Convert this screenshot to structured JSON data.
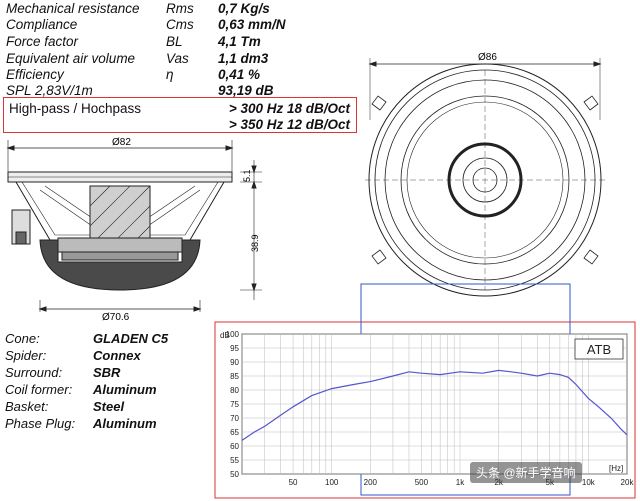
{
  "specs": [
    {
      "label": "Mechanical resistance",
      "symbol": "Rms",
      "value": "0,7 Kg/s"
    },
    {
      "label": "Compliance",
      "symbol": "Cms",
      "value": "0,63 mm/N"
    },
    {
      "label": "Force factor",
      "symbol": "BL",
      "value": "4,1 Tm"
    },
    {
      "label": "Equivalent air volume",
      "symbol": "Vas",
      "value": "1,1 dm3"
    },
    {
      "label": "Efficiency",
      "symbol": "η",
      "value": "0,41 %"
    },
    {
      "label": "SPL 2,83V/1m",
      "symbol": "",
      "value": "93,19 dB"
    }
  ],
  "highpass": {
    "label": "High-pass / Hochpass",
    "values": [
      "> 300 Hz 18 dB/Oct",
      "> 350 Hz 12 dB/Oct"
    ]
  },
  "materials": [
    {
      "label": "Cone:",
      "value": "GLADEN C5"
    },
    {
      "label": "Spider:",
      "value": "Connex"
    },
    {
      "label": "Surround:",
      "value": "SBR"
    },
    {
      "label": "Coil former:",
      "value": "Aluminum"
    },
    {
      "label": "Basket:",
      "value": "Steel"
    },
    {
      "label": "Phase Plug:",
      "value": "Aluminum"
    }
  ],
  "drawing": {
    "side_dims": {
      "top_diameter": "Ø82",
      "height_small": "5.1",
      "height": "38.9",
      "bottom_diameter": "Ø70.6"
    },
    "front_dim": "Ø86"
  },
  "watermark": "头条 @新手学音响",
  "chart_data": {
    "type": "line",
    "title": "",
    "label_box": "ATB",
    "ylabel": "dB",
    "xlabel": "[Hz]",
    "y_scale": "linear",
    "x_scale": "log",
    "ylim": [
      50,
      100
    ],
    "xlim": [
      20,
      20000
    ],
    "y_ticks": [
      50,
      55,
      60,
      65,
      70,
      75,
      80,
      85,
      90,
      95,
      100
    ],
    "x_ticks": [
      {
        "value": 50,
        "label": "50"
      },
      {
        "value": 100,
        "label": "100"
      },
      {
        "value": 200,
        "label": "200"
      },
      {
        "value": 500,
        "label": "500"
      },
      {
        "value": 1000,
        "label": "1k"
      },
      {
        "value": 2000,
        "label": "2k"
      },
      {
        "value": 5000,
        "label": "5k"
      },
      {
        "value": 10000,
        "label": "10k"
      },
      {
        "value": 20000,
        "label": "20k"
      }
    ],
    "grid": true,
    "series": [
      {
        "color": "#5555cc",
        "x": [
          20,
          25,
          30,
          40,
          50,
          70,
          100,
          150,
          200,
          300,
          400,
          500,
          700,
          1000,
          1500,
          2000,
          2500,
          3000,
          4000,
          5000,
          6000,
          7000,
          8000,
          10000,
          12000,
          15000,
          18000,
          20000
        ],
        "y": [
          62,
          65,
          67,
          71,
          74,
          78,
          80.5,
          82,
          83,
          85,
          86.5,
          86,
          85.5,
          86.5,
          86,
          87,
          86.5,
          86,
          85,
          86,
          85.5,
          84.5,
          82,
          77,
          74,
          70,
          66,
          64
        ]
      }
    ]
  }
}
